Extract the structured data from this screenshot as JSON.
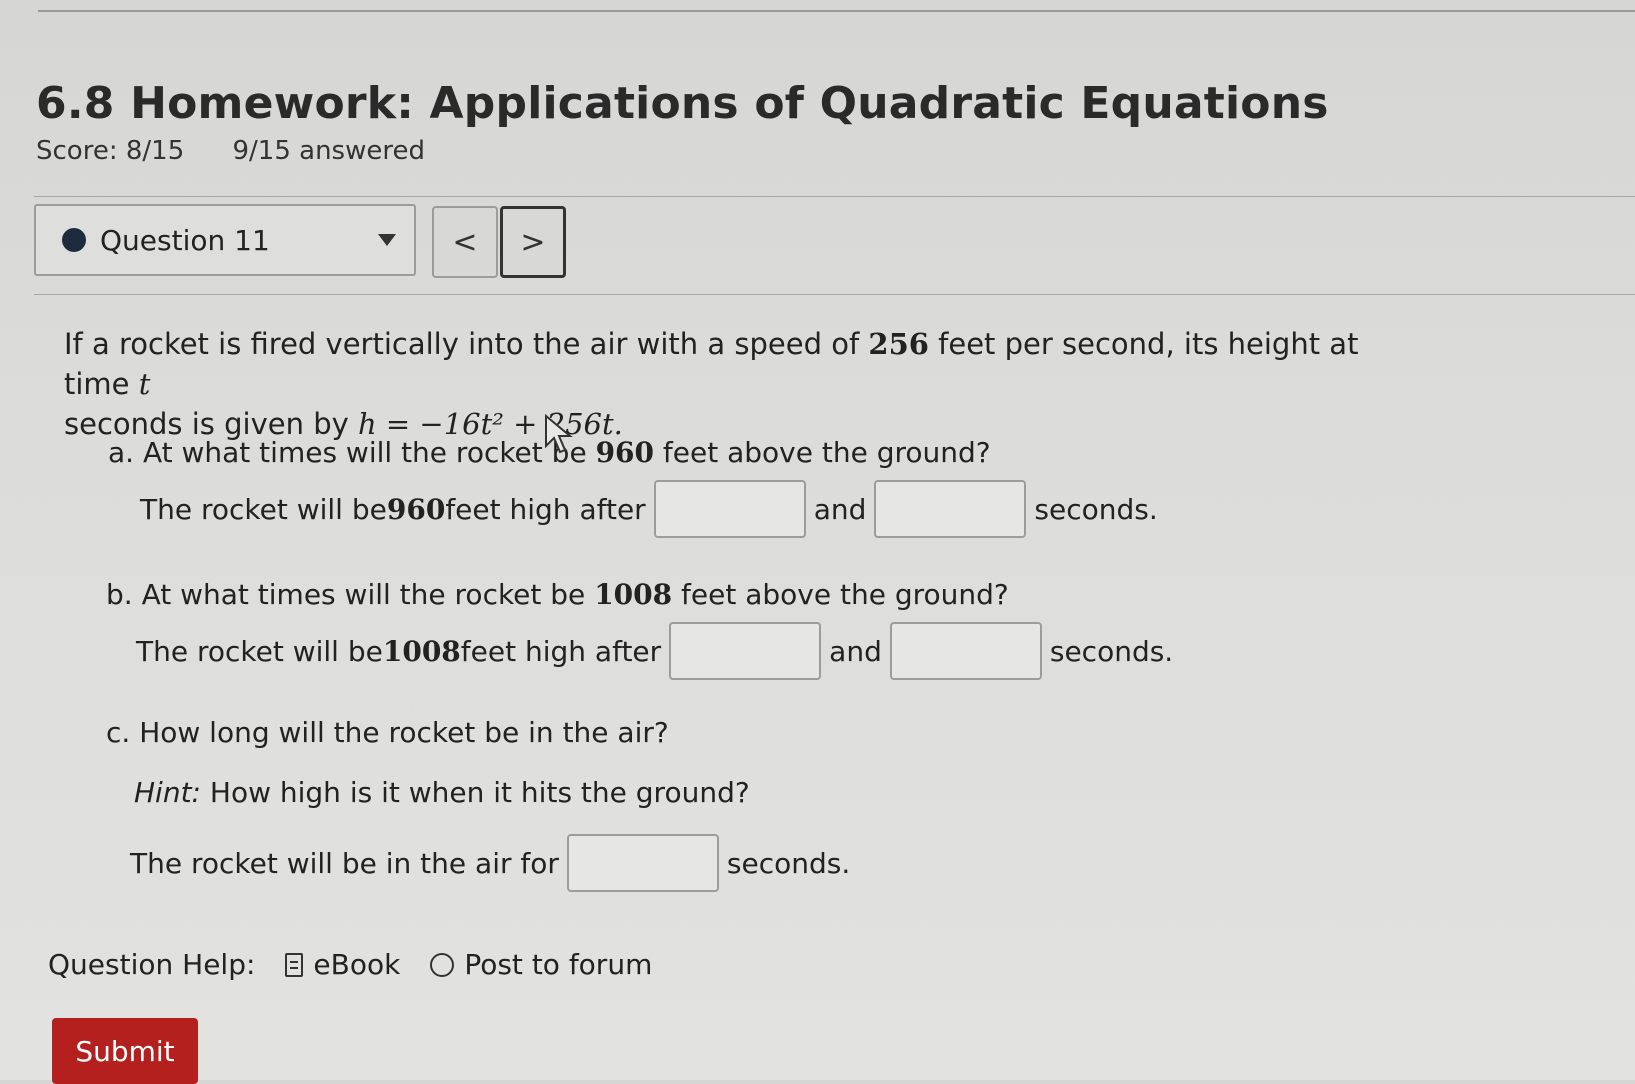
{
  "header": {
    "title": "6.8 Homework: Applications of Quadratic Equations",
    "score": "Score: 8/15",
    "answered": "9/15 answered"
  },
  "question_nav": {
    "selected": "Question 11",
    "prev_label": "<",
    "next_label": ">"
  },
  "problem": {
    "intro_1": "If a rocket is fired vertically into the air with a speed of ",
    "speed": "256",
    "intro_2": " feet per second, its height at time ",
    "var_t": "t",
    "intro_3": " seconds is given by ",
    "formula": "h = −16t² + 256t."
  },
  "parts": [
    {
      "question_1": "a. At what times will the rocket be ",
      "height": "960",
      "question_2": " feet above the ground?",
      "answer_1": "The rocket will be ",
      "answer_2": " feet high after",
      "connector": "and",
      "unit": "seconds."
    },
    {
      "question_1": "b. At what times will the rocket be ",
      "height": "1008",
      "question_2": " feet above the ground?",
      "answer_1": "The rocket will be ",
      "answer_2": " feet high after",
      "connector": "and",
      "unit": "seconds."
    },
    {
      "question": "c. How long will the rocket be in the air?",
      "hint_label": "Hint:",
      "hint_text": " How high is it when it hits the ground?",
      "answer": "The rocket will be in the air for",
      "unit": "seconds."
    }
  ],
  "help": {
    "label": "Question Help:",
    "ebook": "eBook",
    "forum": "Post to forum"
  },
  "submit_label": "Submit",
  "colors": {
    "submit_bg": "#b3201e",
    "dot": "#1e2b3e"
  }
}
